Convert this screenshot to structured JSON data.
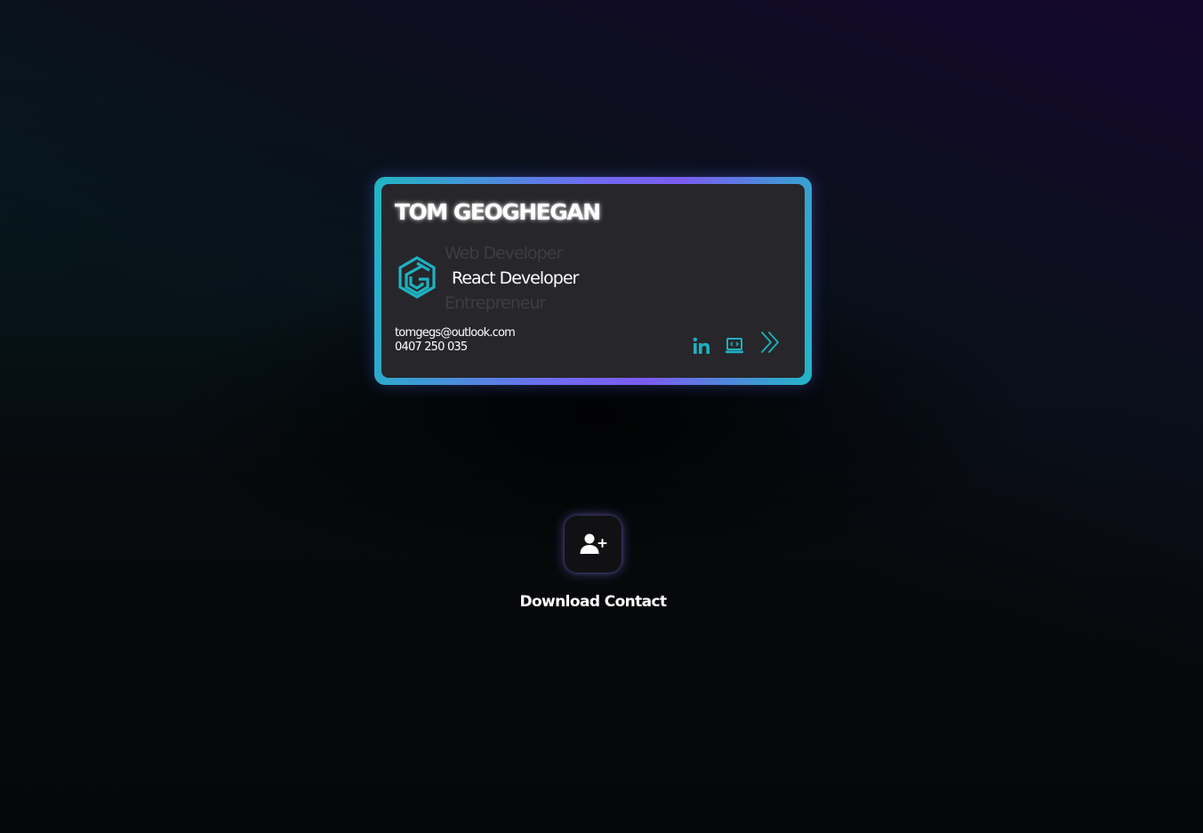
{
  "card": {
    "name": "TOM GEOGHEGAN",
    "roles": [
      "Web Developer",
      "React Developer",
      "Entrepreneur"
    ],
    "active_role_index": 1,
    "email": "tomgegs@outlook.com",
    "phone": "0407 250 035",
    "social_icons": [
      "linkedin-icon",
      "laptop-code-icon",
      "double-chevron-right-icon"
    ]
  },
  "download": {
    "icon": "user-plus-icon",
    "label": "Download Contact"
  },
  "colors": {
    "accent_teal": "#20b6c3",
    "accent_purple": "#7b5cf0",
    "card_bg": "#27272b",
    "page_bg": "#060709"
  }
}
